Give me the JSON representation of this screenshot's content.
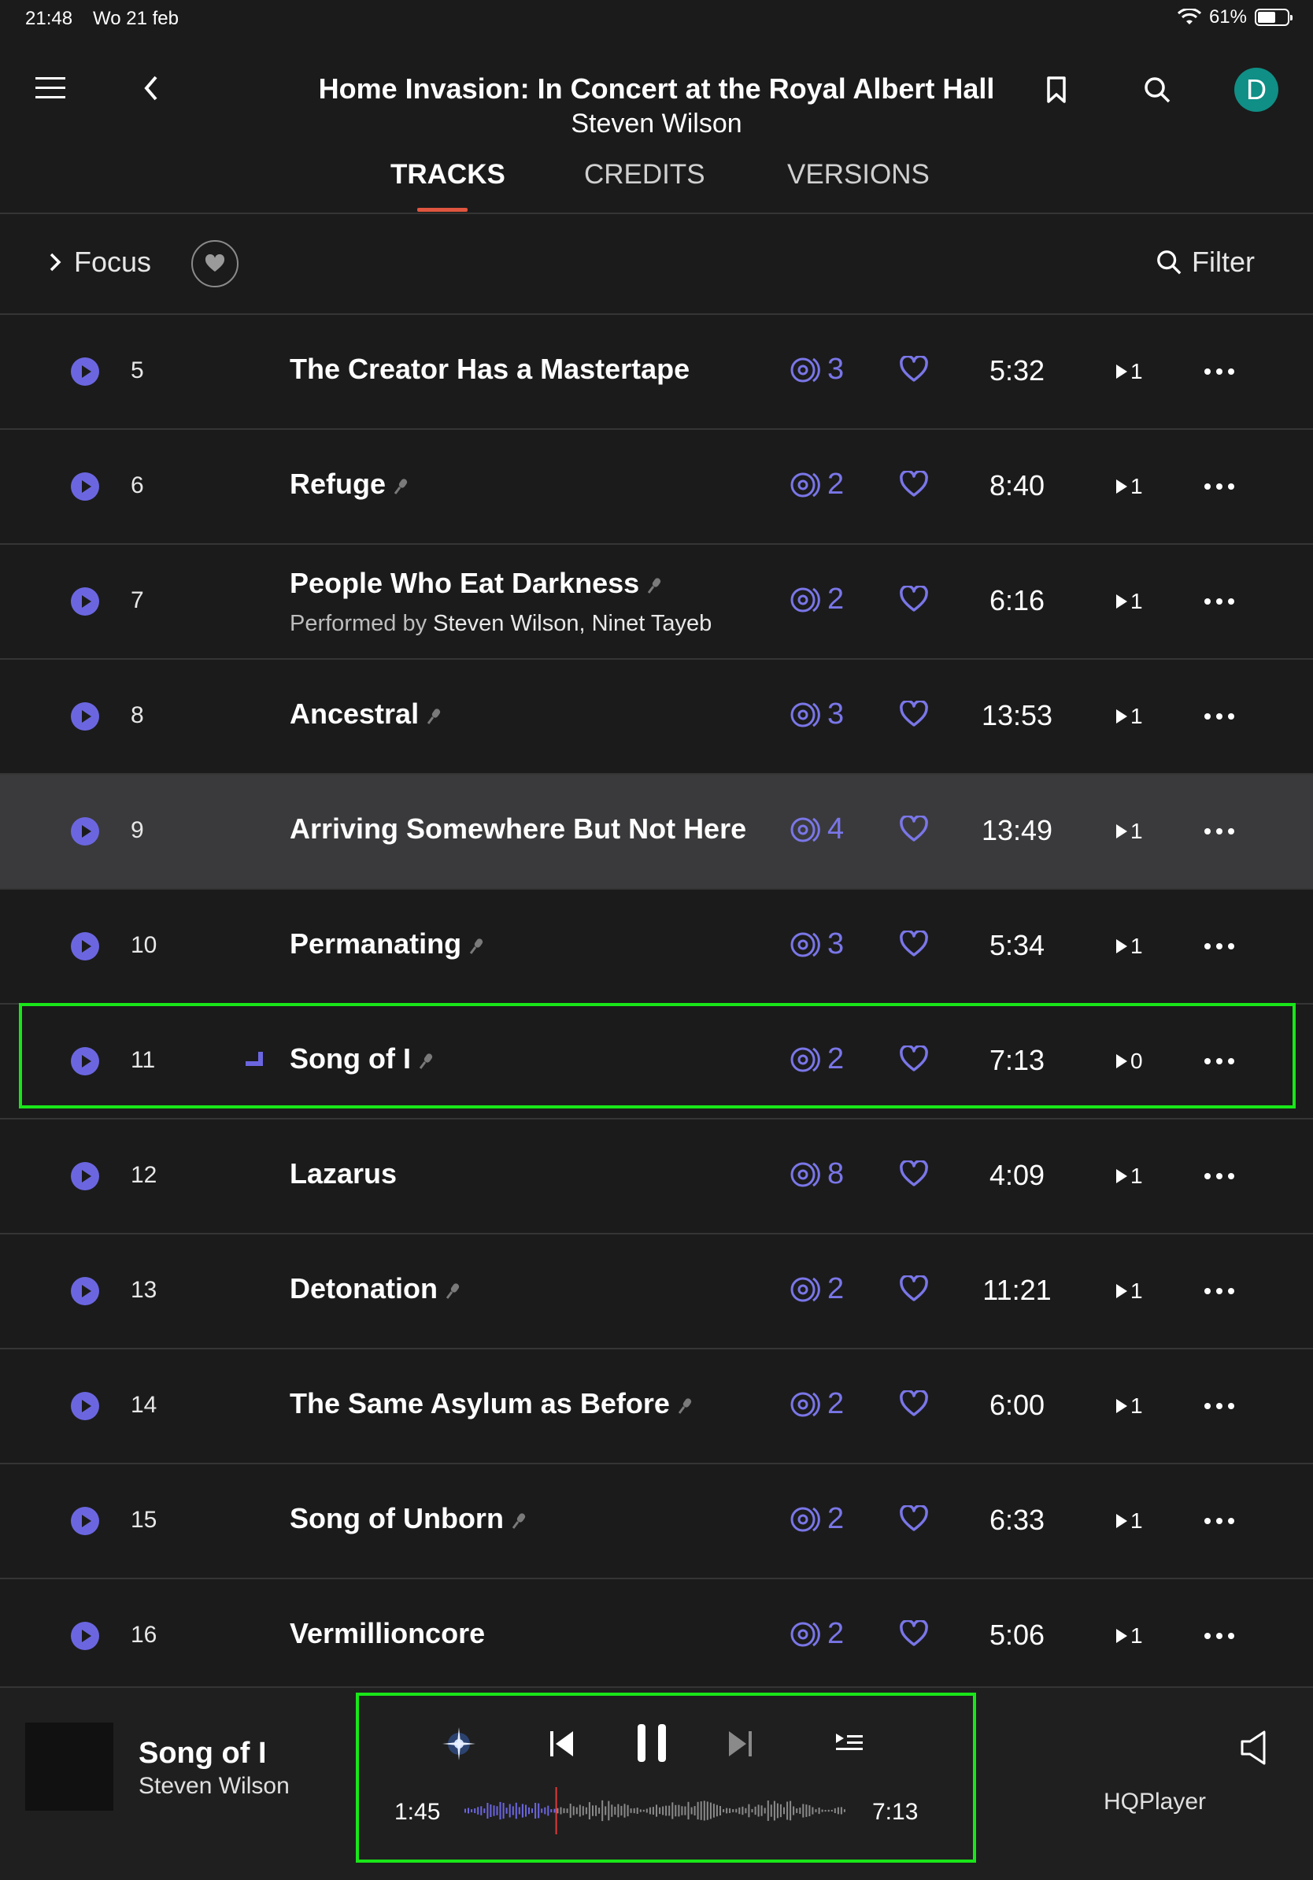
{
  "status_bar": {
    "time": "21:48",
    "date": "Wo 21 feb",
    "battery": "61%"
  },
  "header": {
    "album_title": "Home Invasion: In Concert at the Royal Albert Hall",
    "artist": "Steven Wilson",
    "avatar_letter": "D",
    "tabs": [
      {
        "label": "TRACKS",
        "active": true
      },
      {
        "label": "CREDITS",
        "active": false
      },
      {
        "label": "VERSIONS",
        "active": false
      }
    ]
  },
  "toolbar": {
    "focus_label": "Focus",
    "filter_label": "Filter"
  },
  "tracks": [
    {
      "num": "5",
      "title": "The Creator Has a Mastertape",
      "versions": "3",
      "duration": "5:32",
      "plays": "1",
      "mic": false
    },
    {
      "num": "6",
      "title": "Refuge",
      "versions": "2",
      "duration": "8:40",
      "plays": "1",
      "mic": true
    },
    {
      "num": "7",
      "title": "People Who Eat Darkness",
      "performed_prefix": "Performed by",
      "performed_by": "Steven Wilson, Ninet Tayeb",
      "versions": "2",
      "duration": "6:16",
      "plays": "1",
      "mic": true
    },
    {
      "num": "8",
      "title": "Ancestral",
      "versions": "3",
      "duration": "13:53",
      "plays": "1",
      "mic": true
    },
    {
      "num": "9",
      "title": "Arriving Somewhere But Not Here",
      "versions": "4",
      "duration": "13:49",
      "plays": "1",
      "mic": false,
      "highlighted": true
    },
    {
      "num": "10",
      "title": "Permanating",
      "versions": "3",
      "duration": "5:34",
      "plays": "1",
      "mic": true
    },
    {
      "num": "11",
      "title": "Song of I",
      "versions": "2",
      "duration": "7:13",
      "plays": "0",
      "mic": true,
      "now_playing": true
    },
    {
      "num": "12",
      "title": "Lazarus",
      "versions": "8",
      "duration": "4:09",
      "plays": "1",
      "mic": false
    },
    {
      "num": "13",
      "title": "Detonation",
      "versions": "2",
      "duration": "11:21",
      "plays": "1",
      "mic": true
    },
    {
      "num": "14",
      "title": "The Same Asylum as Before",
      "versions": "2",
      "duration": "6:00",
      "plays": "1",
      "mic": true
    },
    {
      "num": "15",
      "title": "Song of Unborn",
      "versions": "2",
      "duration": "6:33",
      "plays": "1",
      "mic": true
    },
    {
      "num": "16",
      "title": "Vermillioncore",
      "versions": "2",
      "duration": "5:06",
      "plays": "1",
      "mic": false
    }
  ],
  "player": {
    "title": "Song of I",
    "artist": "Steven Wilson",
    "elapsed": "1:45",
    "total": "7:13",
    "progress_fraction": 0.24,
    "zone": "HQPlayer"
  },
  "colors": {
    "accent": "#6b66e0",
    "tab_underline": "#e0553f",
    "avatar": "#0f8f86",
    "highlight_box": "#19e619"
  },
  "icons": [
    "menu-icon",
    "back-icon",
    "bookmark-icon",
    "search-icon",
    "chevron-right-icon",
    "heart-icon",
    "play-icon",
    "versions-icon",
    "more-icon",
    "mic-icon",
    "radio-icon",
    "previous-icon",
    "pause-icon",
    "next-icon",
    "queue-icon",
    "volume-icon"
  ]
}
